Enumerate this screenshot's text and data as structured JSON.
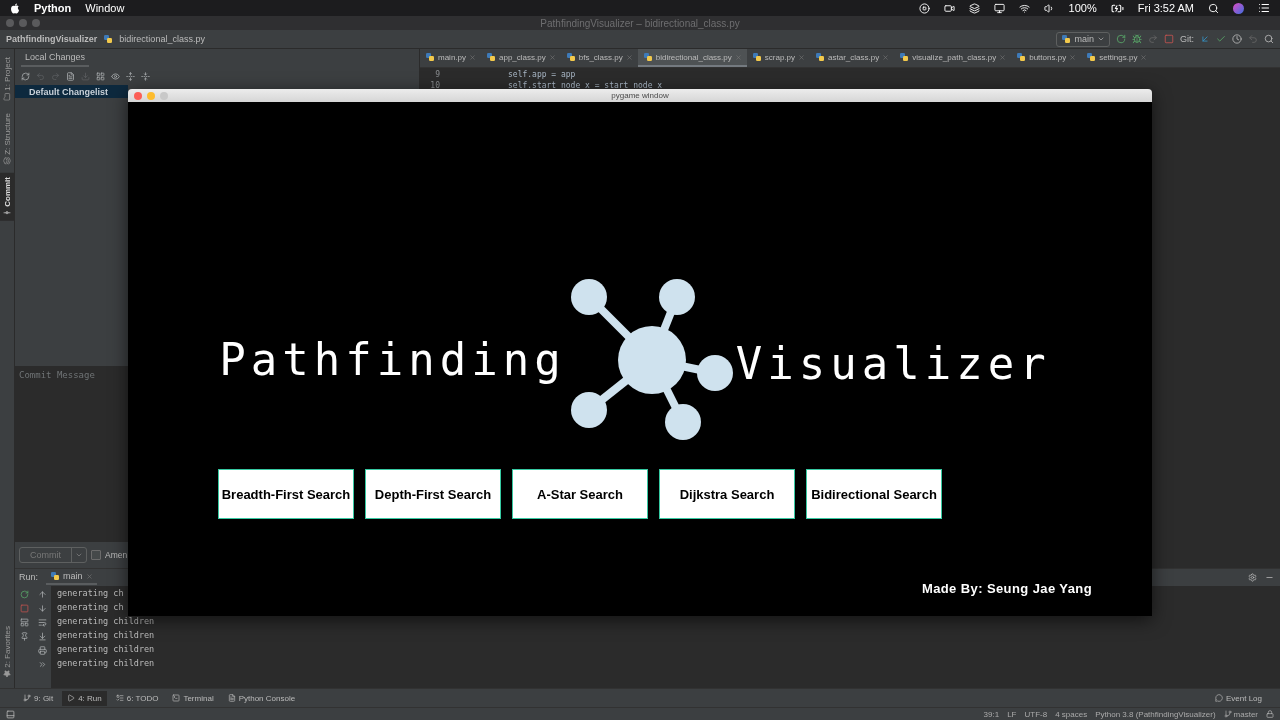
{
  "menubar": {
    "app": "Python",
    "menus": [
      "Window"
    ],
    "battery": "100%",
    "clock": "Fri 3:52 AM"
  },
  "ide": {
    "title": "PathfindingVisualizer – bidirectional_class.py",
    "breadcrumb": [
      "PathfindingVisualizer",
      "bidirectional_class.py"
    ],
    "run_config": "main",
    "git_label": "Git:",
    "tool_strip": [
      {
        "label": "1: Project",
        "selected": false
      },
      {
        "label": "Z: Structure",
        "selected": false
      },
      {
        "label": "Commit",
        "selected": true
      }
    ],
    "favorites": "2: Favorites",
    "commit_panel": {
      "tab": "Local Changes",
      "changelist": {
        "label": "Default Changelist",
        "selected": true
      },
      "placeholder": "Commit Message",
      "commit_button": "Commit",
      "amend_label": "Amen",
      "amend_checked": false
    },
    "editor_tabs": [
      {
        "label": "main.py",
        "selected": false
      },
      {
        "label": "app_class.py",
        "selected": false
      },
      {
        "label": "bfs_class.py",
        "selected": false
      },
      {
        "label": "bidirectional_class.py",
        "selected": true
      },
      {
        "label": "scrap.py",
        "selected": false
      },
      {
        "label": "astar_class.py",
        "selected": false
      },
      {
        "label": "visualize_path_class.py",
        "selected": false
      },
      {
        "label": "buttons.py",
        "selected": false
      },
      {
        "label": "settings.py",
        "selected": false
      }
    ],
    "code_lines": [
      {
        "number": "9",
        "code": "self.app = app"
      },
      {
        "number": "10",
        "code": "self.start_node_x = start_node_x"
      }
    ],
    "run": {
      "label": "Run:",
      "tab": "main",
      "output": [
        "generating ch",
        "generating ch",
        "generating children",
        "generating children",
        "generating children",
        "generating children"
      ]
    },
    "tool_windows": [
      {
        "label": "9: Git",
        "selected": false
      },
      {
        "label": "4: Run",
        "selected": true
      },
      {
        "label": "6: TODO",
        "selected": false
      },
      {
        "label": "Terminal",
        "selected": false
      },
      {
        "label": "Python Console",
        "selected": false
      }
    ],
    "event_log": "Event Log",
    "status": [
      "39:1",
      "LF",
      "UTF-8",
      "4 spaces",
      "Python 3.8 (PathfindingVisualizer)"
    ],
    "branch": "master"
  },
  "pygame": {
    "title": "pygame window",
    "heading": [
      "Pathfinding",
      "Visualizer"
    ],
    "buttons": [
      "Breadth-First Search",
      "Depth-First Search",
      "A-Star Search",
      "Dijkstra Search",
      "Bidirectional Search"
    ],
    "credit": "Made By: Seung Jae Yang"
  }
}
